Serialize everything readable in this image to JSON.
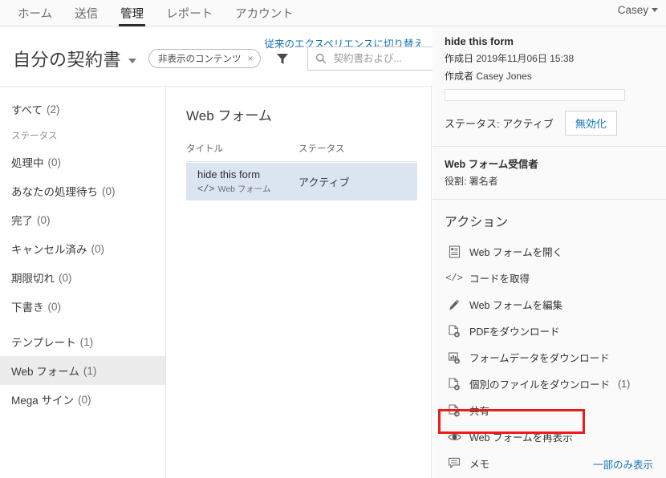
{
  "topnav": {
    "items": [
      {
        "label": "ホーム",
        "active": false
      },
      {
        "label": "送信",
        "active": false
      },
      {
        "label": "管理",
        "active": true
      },
      {
        "label": "レポート",
        "active": false
      },
      {
        "label": "アカウント",
        "active": false
      }
    ],
    "user": "Casey"
  },
  "header": {
    "legacy_link": "従来のエクスペリエンスに切り替え",
    "page_title": "自分の契約書",
    "filter_chip": "非表示のコンテンツ",
    "chip_remove": "×",
    "search_placeholder": "契約書および...",
    "search_value": ""
  },
  "sidebar": {
    "all": {
      "label": "すべて",
      "count": "(2)"
    },
    "status_heading": "ステータス",
    "status_items": [
      {
        "label": "処理中",
        "count": "(0)"
      },
      {
        "label": "あなたの処理待ち",
        "count": "(0)"
      },
      {
        "label": "完了",
        "count": "(0)"
      },
      {
        "label": "キャンセル済み",
        "count": "(0)"
      },
      {
        "label": "期限切れ",
        "count": "(0)"
      },
      {
        "label": "下書き",
        "count": "(0)"
      }
    ],
    "template_heading": {
      "label": "テンプレート",
      "count": "(1)"
    },
    "template_items": [
      {
        "label": "Web フォーム",
        "count": "(1)",
        "selected": true
      },
      {
        "label": "Mega サイン",
        "count": "(0)",
        "selected": false
      }
    ]
  },
  "center": {
    "title": "Web フォーム",
    "columns": {
      "title": "タイトル",
      "status": "ステータス"
    },
    "rows": [
      {
        "name": "hide this form",
        "type": "Web フォーム",
        "status": "アクティブ"
      }
    ]
  },
  "detail": {
    "title": "hide this form",
    "created_label": "作成日",
    "created_value": "2019年11月06日  15:38",
    "author_label": "作成者",
    "author_value": "Casey Jones",
    "note_value": "",
    "status_label": "ステータス:",
    "status_value": "アクティブ",
    "deactivate_button": "無効化",
    "recipients_title": "Web フォーム受信者",
    "recipients_role": "役割: 署名者",
    "actions_heading": "アクション",
    "actions": [
      {
        "label": "Web フォームを開く",
        "icon": "document-open-icon",
        "count": ""
      },
      {
        "label": "コードを取得",
        "icon": "code-icon",
        "count": ""
      },
      {
        "label": "Web フォームを編集",
        "icon": "pencil-icon",
        "count": ""
      },
      {
        "label": "PDFをダウンロード",
        "icon": "pdf-download-icon",
        "count": ""
      },
      {
        "label": "フォームデータをダウンロード",
        "icon": "chart-download-icon",
        "count": ""
      },
      {
        "label": "個別のファイルをダウンロード",
        "icon": "file-download-icon",
        "count": "(1)"
      },
      {
        "label": "共有",
        "icon": "share-icon",
        "count": ""
      },
      {
        "label": "Web フォームを再表示",
        "icon": "eye-icon",
        "count": "",
        "highlighted": true
      },
      {
        "label": "メモ",
        "icon": "note-icon",
        "count": ""
      }
    ],
    "show_less": "一部のみ表示"
  },
  "colors": {
    "accent_link": "#1473b5",
    "highlight_border": "#ee1b1b",
    "row_selected": "#dbe5f1",
    "sidebar_selected": "#ececec"
  }
}
